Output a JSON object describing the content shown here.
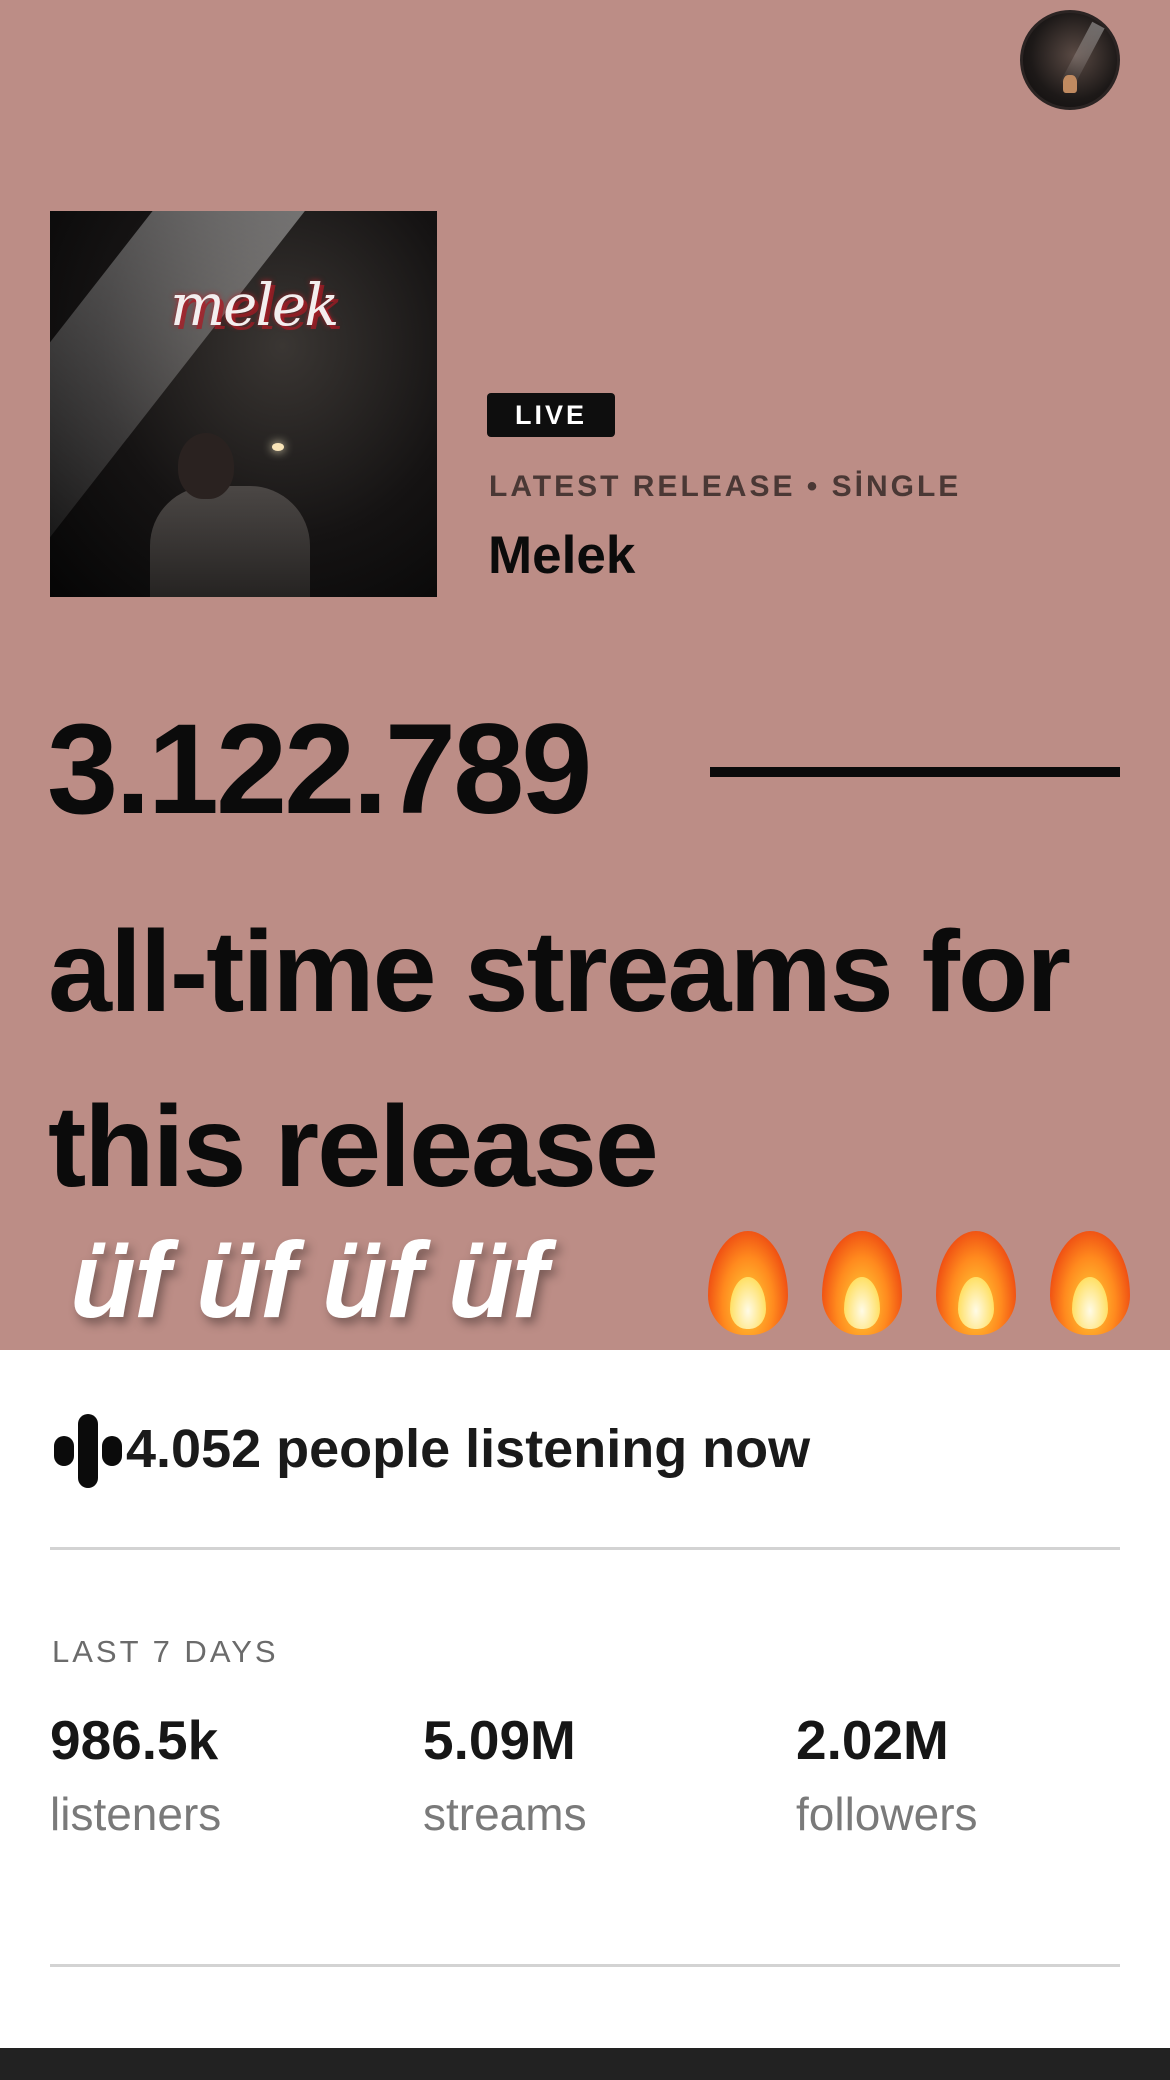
{
  "release": {
    "badge": "LIVE",
    "label": "LATEST RELEASE • SİNGLE",
    "title": "Melek",
    "cover_text": "melek"
  },
  "streams": {
    "count": "3.122.789",
    "caption": "all-time streams for this release"
  },
  "overlay": {
    "text": "üf üf üf üf",
    "emoji_icon": "fire-icon",
    "emoji_count": 4
  },
  "live": {
    "listening_text": "4.052 people listening now"
  },
  "last7days": {
    "label": "LAST 7 DAYS",
    "stats": [
      {
        "value": "986.5k",
        "label": "listeners"
      },
      {
        "value": "5.09M",
        "label": "streams"
      },
      {
        "value": "2.02M",
        "label": "followers"
      }
    ]
  },
  "colors": {
    "hero_bg": "#bc8d86",
    "text_dark": "#0b0b0b",
    "muted": "#7a7a7a"
  }
}
